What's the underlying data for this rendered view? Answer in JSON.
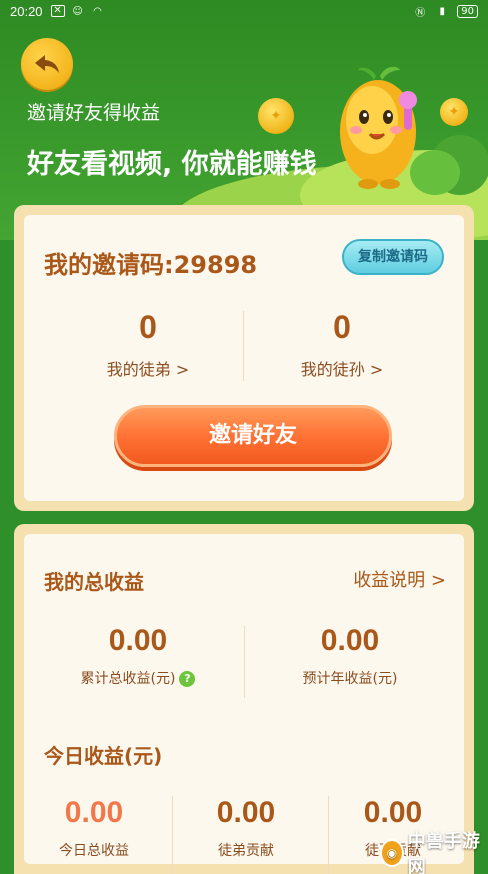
{
  "status": {
    "time": "20:20",
    "battery": "90"
  },
  "header": {
    "subtitle": "邀请好友得收益",
    "title": "好友看视频, 你就能赚钱"
  },
  "invite_card": {
    "code_label": "我的邀请码:29898",
    "copy_button": "复制邀请码",
    "disciples_count": "0",
    "disciples_label": "我的徒弟 >",
    "grand_disciples_count": "0",
    "grand_disciples_label": "我的徒孙 >",
    "invite_button": "邀请好友"
  },
  "earnings_card": {
    "title": "我的总收益",
    "explain_link": "收益说明 >",
    "total": {
      "value": "0.00",
      "label": "累计总收益(元)"
    },
    "yearly": {
      "value": "0.00",
      "label": "预计年收益(元)"
    },
    "today_title": "今日收益(元)",
    "today": [
      {
        "value": "0.00",
        "label": "今日总收益"
      },
      {
        "value": "0.00",
        "label": "徒弟贡献"
      },
      {
        "value": "0.00",
        "label": "徒孙贡献"
      }
    ]
  },
  "watermark": {
    "text": "中兽手游网"
  },
  "colors": {
    "hero_green": "#2e8a23",
    "card_border": "#f5e0b0",
    "brown_text": "#a9581a",
    "orange_button": "#ff6f32",
    "highlight_value": "#f2784a",
    "copy_button": "#5ecde0"
  }
}
